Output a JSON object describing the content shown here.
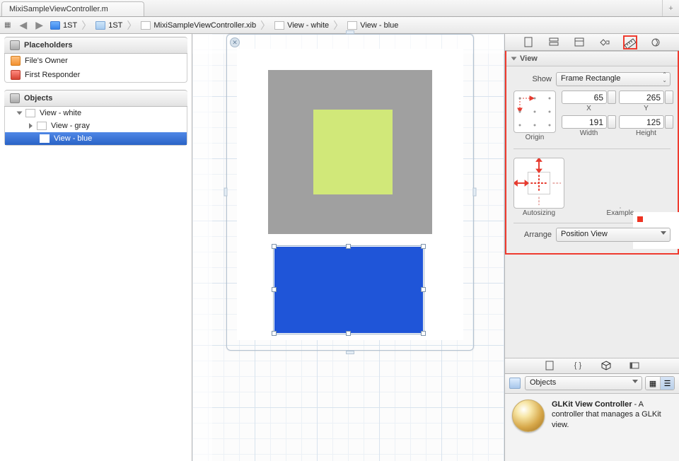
{
  "tab": {
    "title": "MixiSampleViewController.m"
  },
  "jumpbar": {
    "proj": "1ST",
    "folder": "1ST",
    "file": "MixiSampleViewController.xib",
    "view1": "View - white",
    "view2": "View - blue"
  },
  "placeholders": {
    "header": "Placeholders",
    "filesOwner": "File's Owner",
    "firstResponder": "First Responder"
  },
  "objects": {
    "header": "Objects",
    "white": "View - white",
    "gray": "View - gray",
    "blue": "View - blue"
  },
  "inspector": {
    "viewHeader": "View",
    "showLabel": "Show",
    "showValue": "Frame Rectangle",
    "x": "65",
    "xLabel": "X",
    "y": "265",
    "yLabel": "Y",
    "w": "191",
    "wLabel": "Width",
    "h": "125",
    "hLabel": "Height",
    "originLabel": "Origin",
    "autosizingLabel": "Autosizing",
    "exampleLabel": "Example",
    "arrangeLabel": "Arrange",
    "arrangeValue": "Position View"
  },
  "library": {
    "dropdown": "Objects",
    "itemTitle": "GLKit View Controller",
    "itemDesc": " - A controller that manages a GLKit view."
  }
}
